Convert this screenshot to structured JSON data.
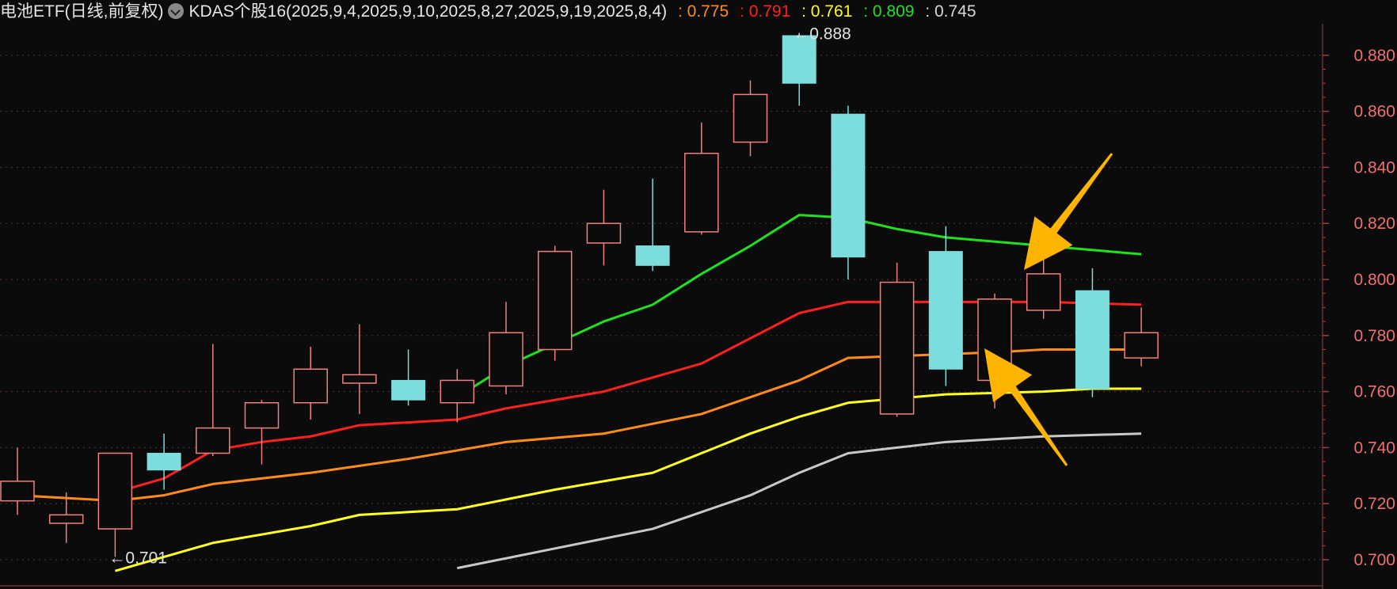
{
  "header": {
    "title": "电池ETF(日线,前复权)",
    "indicator": "KDAS个股16(2025,9,4,2025,9,10,2025,8,27,2025,9,19,2025,8,4)",
    "values": [
      {
        "text": ": 0.775",
        "color": "#ff8c1a"
      },
      {
        "text": ": 0.791",
        "color": "#ff2020"
      },
      {
        "text": ": 0.761",
        "color": "#ffff20"
      },
      {
        "text": ": 0.809",
        "color": "#20e020"
      },
      {
        "text": ": 0.745",
        "color": "#d8d8d8"
      }
    ]
  },
  "colors": {
    "background": "#0b0b0b",
    "up": "#f08080",
    "down": "#7ddcdc",
    "grid": "#5a3030",
    "axis_text": "#f07070",
    "arrow": "#ffb400"
  },
  "chart_data": {
    "type": "candlestick",
    "ylim": [
      0.695,
      0.894
    ],
    "y_ticks": [
      "0.700",
      "0.720",
      "0.740",
      "0.760",
      "0.780",
      "0.800",
      "0.820",
      "0.840",
      "0.860",
      "0.880"
    ],
    "candles": [
      {
        "o": 0.721,
        "h": 0.74,
        "l": 0.716,
        "c": 0.728
      },
      {
        "o": 0.713,
        "h": 0.724,
        "l": 0.706,
        "c": 0.716
      },
      {
        "o": 0.711,
        "h": 0.738,
        "l": 0.701,
        "c": 0.738
      },
      {
        "o": 0.738,
        "h": 0.745,
        "l": 0.725,
        "c": 0.732
      },
      {
        "o": 0.738,
        "h": 0.777,
        "l": 0.737,
        "c": 0.747
      },
      {
        "o": 0.747,
        "h": 0.757,
        "l": 0.734,
        "c": 0.756
      },
      {
        "o": 0.756,
        "h": 0.776,
        "l": 0.75,
        "c": 0.768
      },
      {
        "o": 0.763,
        "h": 0.784,
        "l": 0.752,
        "c": 0.766
      },
      {
        "o": 0.764,
        "h": 0.775,
        "l": 0.755,
        "c": 0.757
      },
      {
        "o": 0.756,
        "h": 0.768,
        "l": 0.749,
        "c": 0.764
      },
      {
        "o": 0.762,
        "h": 0.792,
        "l": 0.759,
        "c": 0.781
      },
      {
        "o": 0.775,
        "h": 0.812,
        "l": 0.771,
        "c": 0.81
      },
      {
        "o": 0.813,
        "h": 0.832,
        "l": 0.805,
        "c": 0.82
      },
      {
        "o": 0.812,
        "h": 0.836,
        "l": 0.803,
        "c": 0.805
      },
      {
        "o": 0.817,
        "h": 0.856,
        "l": 0.816,
        "c": 0.845
      },
      {
        "o": 0.849,
        "h": 0.871,
        "l": 0.844,
        "c": 0.866
      },
      {
        "o": 0.887,
        "h": 0.888,
        "l": 0.862,
        "c": 0.87
      },
      {
        "o": 0.859,
        "h": 0.862,
        "l": 0.8,
        "c": 0.808
      },
      {
        "o": 0.752,
        "h": 0.806,
        "l": 0.751,
        "c": 0.799
      },
      {
        "o": 0.81,
        "h": 0.819,
        "l": 0.762,
        "c": 0.768
      },
      {
        "o": 0.764,
        "h": 0.795,
        "l": 0.754,
        "c": 0.793
      },
      {
        "o": 0.789,
        "h": 0.811,
        "l": 0.786,
        "c": 0.802
      },
      {
        "o": 0.796,
        "h": 0.804,
        "l": 0.758,
        "c": 0.761
      },
      {
        "o": 0.772,
        "h": 0.79,
        "l": 0.769,
        "c": 0.781
      }
    ],
    "series": [
      {
        "color": "#ff8c1a",
        "points": [
          [
            0,
            0.723
          ],
          [
            2,
            0.721
          ],
          [
            3,
            0.723
          ],
          [
            4,
            0.727
          ],
          [
            6,
            0.731
          ],
          [
            8,
            0.736
          ],
          [
            10,
            0.742
          ],
          [
            12,
            0.745
          ],
          [
            14,
            0.752
          ],
          [
            16,
            0.764
          ],
          [
            17,
            0.772
          ],
          [
            20,
            0.774
          ],
          [
            21,
            0.775
          ],
          [
            23,
            0.775
          ]
        ]
      },
      {
        "color": "#ff2020",
        "points": [
          [
            2,
            0.724
          ],
          [
            3,
            0.729
          ],
          [
            4,
            0.739
          ],
          [
            5,
            0.742
          ],
          [
            6,
            0.744
          ],
          [
            7,
            0.748
          ],
          [
            9,
            0.75
          ],
          [
            10,
            0.754
          ],
          [
            12,
            0.76
          ],
          [
            14,
            0.77
          ],
          [
            15,
            0.779
          ],
          [
            16,
            0.788
          ],
          [
            17,
            0.792
          ],
          [
            19,
            0.792
          ],
          [
            21,
            0.792
          ],
          [
            23,
            0.791
          ]
        ]
      },
      {
        "color": "#ffff20",
        "points": [
          [
            2,
            0.696
          ],
          [
            4,
            0.706
          ],
          [
            6,
            0.712
          ],
          [
            7,
            0.716
          ],
          [
            9,
            0.718
          ],
          [
            11,
            0.725
          ],
          [
            13,
            0.731
          ],
          [
            15,
            0.745
          ],
          [
            16,
            0.751
          ],
          [
            17,
            0.756
          ],
          [
            19,
            0.759
          ],
          [
            21,
            0.76
          ],
          [
            22,
            0.761
          ],
          [
            23,
            0.761
          ]
        ]
      },
      {
        "color": "#20e020",
        "points": [
          [
            9,
            0.758
          ],
          [
            10,
            0.769
          ],
          [
            11,
            0.777
          ],
          [
            12,
            0.785
          ],
          [
            13,
            0.791
          ],
          [
            14,
            0.802
          ],
          [
            15,
            0.812
          ],
          [
            16,
            0.823
          ],
          [
            17,
            0.822
          ],
          [
            18,
            0.818
          ],
          [
            19,
            0.815
          ],
          [
            21,
            0.812
          ],
          [
            23,
            0.809
          ]
        ]
      },
      {
        "color": "#c8c8c8",
        "points": [
          [
            9,
            0.697
          ],
          [
            11,
            0.704
          ],
          [
            13,
            0.711
          ],
          [
            15,
            0.723
          ],
          [
            16,
            0.731
          ],
          [
            17,
            0.738
          ],
          [
            18,
            0.74
          ],
          [
            19,
            0.742
          ],
          [
            21,
            0.744
          ],
          [
            23,
            0.745
          ]
        ]
      }
    ],
    "annotations": [
      {
        "text": "0.888",
        "candle": 16,
        "value": 0.888
      },
      {
        "text": "0.701",
        "candle": 2,
        "value": 0.701
      }
    ]
  }
}
